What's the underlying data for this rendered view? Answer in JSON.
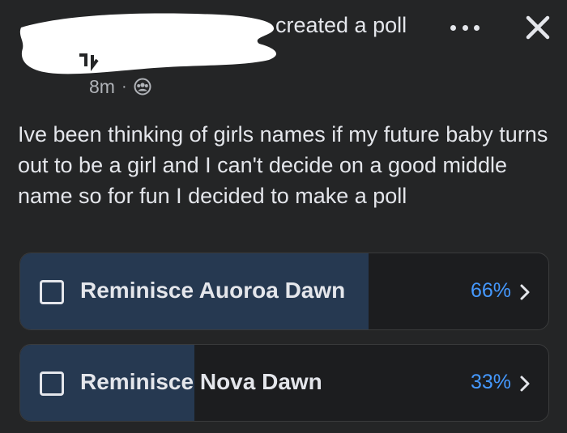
{
  "header": {
    "created_text": "created a poll",
    "timestamp": "8m",
    "separator": "·",
    "audience_icon": "friends-icon",
    "more_icon": "more-dots-icon",
    "close_icon": "close-icon"
  },
  "post": {
    "text": "Ive been thinking of girls names if my future baby turns out to be a girl and I can't decide on a good middle name so for fun I decided to make a poll"
  },
  "poll": {
    "options": [
      {
        "label": "Reminisce Auoroa Dawn",
        "percent_text": "66%",
        "percent": 66
      },
      {
        "label": "Reminisce Nova Dawn",
        "percent_text": "33%",
        "percent": 33
      }
    ]
  },
  "colors": {
    "background": "#242526",
    "text": "#e4e6eb",
    "muted": "#b0b3b8",
    "accent": "#4599ff",
    "poll_fill": "#263951",
    "poll_bg": "#1c1d1f"
  }
}
